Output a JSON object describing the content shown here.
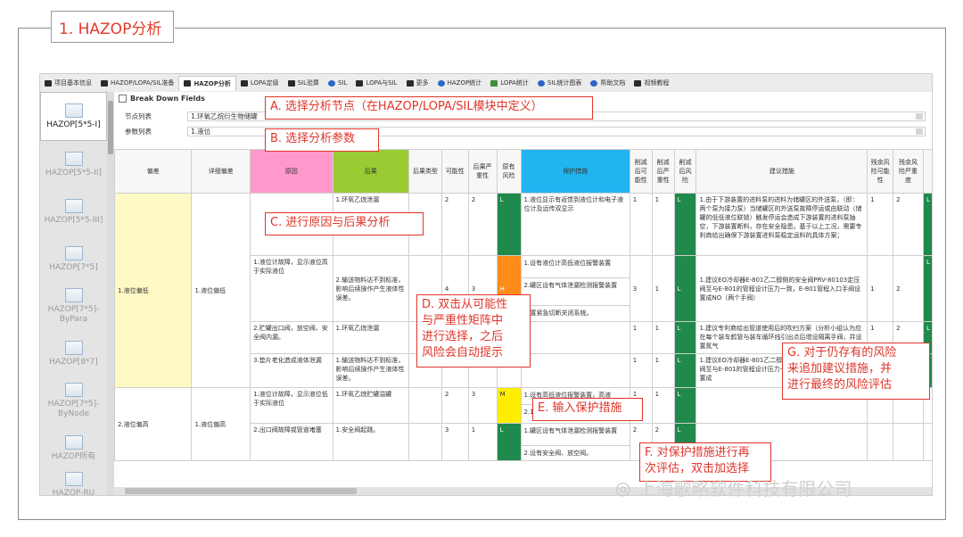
{
  "title": "1. HAZOP分析",
  "tabs": [
    {
      "label": "项目基本信息",
      "icon": "grid-icon"
    },
    {
      "label": "HAZOP/LOPA/SIL准备",
      "icon": "grid-icon"
    },
    {
      "label": "HAZOP分析",
      "icon": "grid-icon",
      "active": true
    },
    {
      "label": "LOPA定级",
      "icon": "grid-icon"
    },
    {
      "label": "SIL验算",
      "icon": "grid-icon"
    },
    {
      "label": "SIL",
      "icon": "chart-icon"
    },
    {
      "label": "LOPA与SIL",
      "icon": "grid-icon"
    },
    {
      "label": "更多",
      "icon": "grid-icon"
    },
    {
      "label": "HAZOP统计",
      "icon": "export-icon"
    },
    {
      "label": "LOPA统计",
      "icon": "bar-chart-icon"
    },
    {
      "label": "SIL统计图表",
      "icon": "pie-icon"
    },
    {
      "label": "帮助文档",
      "icon": "help-icon"
    },
    {
      "label": "视频教程",
      "icon": "video-icon"
    }
  ],
  "sidebar": [
    {
      "label": "HAZOP[5*5-I]",
      "active": true
    },
    {
      "label": "HAZOP[5*5-II]"
    },
    {
      "label": "HAZOP[5*5-III]"
    },
    {
      "label": "HAZOP[7*5]"
    },
    {
      "label": "HAZOP[7*5]-ByPara"
    },
    {
      "label": "HAZOP[8*7]"
    },
    {
      "label": "HAZOP[7*5]-ByNode"
    },
    {
      "label": "HAZOP所有"
    },
    {
      "label": "HAZOP-RU"
    }
  ],
  "bdf": {
    "title": "Break Down Fields",
    "node_label": "节点列表",
    "node_value": "1.环氧乙烷衍生物储罐",
    "param_label": "参数列表",
    "param_value": "1.液位"
  },
  "columns": [
    "偏差",
    "详细偏差",
    "原因",
    "后果",
    "后果类型",
    "可能性",
    "后果严重性",
    "原有风险",
    "保护措施",
    "削减后可能性",
    "削减后严重性",
    "削减后风险",
    "建议措施",
    "残余风险可能性",
    "残余风险严重度"
  ],
  "rows": {
    "dev1": "1.液位偏低",
    "detail1": "1.液位偏低",
    "dev2": "2.液位偏高",
    "detail2": "1.液位偏高",
    "r1_cause": "",
    "r1_conseq": "1.环氧乙烷泄漏",
    "r1_l": "2",
    "r1_s": "2",
    "r1_risk": "L",
    "r1_prot": "1.液位显示有返馈到液位计和电子液位计及远传双显示",
    "r1_l2": "1",
    "r1_s2": "1",
    "r1_risk2": "L",
    "r1_sugg": "1.由于下游装置的进料泵的进料为储罐区的外送泵，（即：两个泵为接力泵）当储罐区的外送泵故障停运或由联动（储罐的低低液位联锁）触发停运会造成下游装置的进料泵抽空，下游装置断料，存在安全隐患。基于以上工况，需要专利商给出确保下游装置进料泵稳定运料的具体方案；",
    "r1_rl": "1",
    "r1_rs": "2",
    "r1_rr": "L",
    "r2_cause": "1.液位计故障，显示液位高于实际液位",
    "r2_conseq": "2.输送物料达不到标准，影响后续操作产生液体性误差。",
    "r2_l": "4",
    "r2_s": "3",
    "r2_risk": "H",
    "r2_prot1": "1.设有液位计高低液位报警装置",
    "r2_prot2": "2.罐区设有气体泄漏检测报警装置",
    "r2_prot3": "设置紧急切断关闭系统。",
    "r2_l2": "3",
    "r2_s2": "1",
    "r2_risk2": "L",
    "r2_sugg": "1.建议EO冷却器E-801乙二醇侧的安全阀PRV-80103定压阀至与E-801的管程设计压力一致，E-801管程入口手阀设置成NO（两个手阀）",
    "r2_rl": "1",
    "r2_rs": "2",
    "r2_rr": "L",
    "r3_cause": "2.贮罐出口阀，放空阀、安全阀内漏。",
    "r3_conseq": "1.环氧乙烷泄漏",
    "r3_l": "",
    "r3_s": "",
    "r3_risk": "",
    "r3_prot": "",
    "r3_l2": "1",
    "r3_s2": "1",
    "r3_risk2": "L",
    "r3_sugg": "1.建议专利商给出管道使用后的吹扫方案（分析小组认为应在每个装车鹤管与装车循环线引出点后增设隔离手阀，并设置氮气",
    "r3_rl": "1",
    "r3_rs": "2",
    "r3_rr": "L",
    "r4_cause": "3.垫片老化造成液体泄漏",
    "r4_conseq": "1.输送物料达不到标准，影响后续操作产生液体性误差。",
    "r4_l": "",
    "r4_s": "",
    "r4_risk": "",
    "r4_prot": "",
    "r4_l2": "1",
    "r4_s2": "1",
    "r4_risk2": "L",
    "r4_sugg": "1.建议EO冷却器E-801乙二醇侧的安全阀PRV-80103定压阀至与E-801的管程设计压力一致，E-801管程入口手阀设置成",
    "r4_rl": "1",
    "r4_rs": "",
    "r4_rr": "L",
    "r5_cause": "1.液位计故障，显示液位低于实际液位",
    "r5_conseq": "1.环氧乙烷贮罐溢罐",
    "r5_l": "2",
    "r5_s": "3",
    "r5_risk": "M",
    "r5_prot1": "1.设有高低液位报警装置，高液",
    "r5_prot2": "2.1",
    "r5_l2": "1",
    "r5_s2": "1",
    "r5_risk2": "L",
    "r6_cause": "2.出口阀故障或管道堵塞",
    "r6_conseq": "1.安全阀起跳。",
    "r6_l": "3",
    "r6_s": "1",
    "r6_risk": "L",
    "r6_prot1": "1.罐区设有气体泄漏检测报警装置",
    "r6_prot2": "2.设有安全阀、放空阀。",
    "r6_l2": "2",
    "r6_s2": "2",
    "r6_risk2": "L"
  },
  "annotations": {
    "a": "A. 选择分析节点（在HAZOP/LOPA/SIL模块中定义）",
    "b": "B. 选择分析参数",
    "c": "C. 进行原因与后果分析",
    "d1": "D. 双击从可能性",
    "d2": "与严重性矩阵中",
    "d3": "进行选择，之后",
    "d4": "风险会自动提示",
    "e": "E. 输入保护措施",
    "f1": "F. 对保护措施进行再",
    "f2": "次评估，双击加选择",
    "g1": "G. 对于仍存有的风险",
    "g2": "来追加建议措施，并",
    "g3": "进行最终的风险评估"
  },
  "watermark": "上海歌略软件科技有限公司"
}
